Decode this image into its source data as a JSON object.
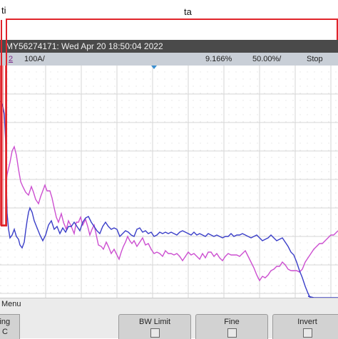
{
  "annotations": {
    "ti_label": "ti",
    "ta_label": "ta"
  },
  "header": {
    "title": "MY56274171: Wed Apr 20 18:50:04 2022"
  },
  "status": {
    "channel_num": "2",
    "scale": "100A/",
    "value": "9.166%",
    "trigger": "50.00%/",
    "run_state": "Stop"
  },
  "menu": {
    "label": "Menu",
    "left_key_line1": "ling",
    "left_key_line2": "C",
    "keys": [
      {
        "label": "BW Limit"
      },
      {
        "label": "Fine"
      },
      {
        "label": "Invert"
      }
    ]
  },
  "colors": {
    "channel_1_trace": "#3a3ec8",
    "channel_2_trace": "#cc4fd0",
    "annotation": "#e0242b",
    "header": "#4a4a4a"
  }
}
